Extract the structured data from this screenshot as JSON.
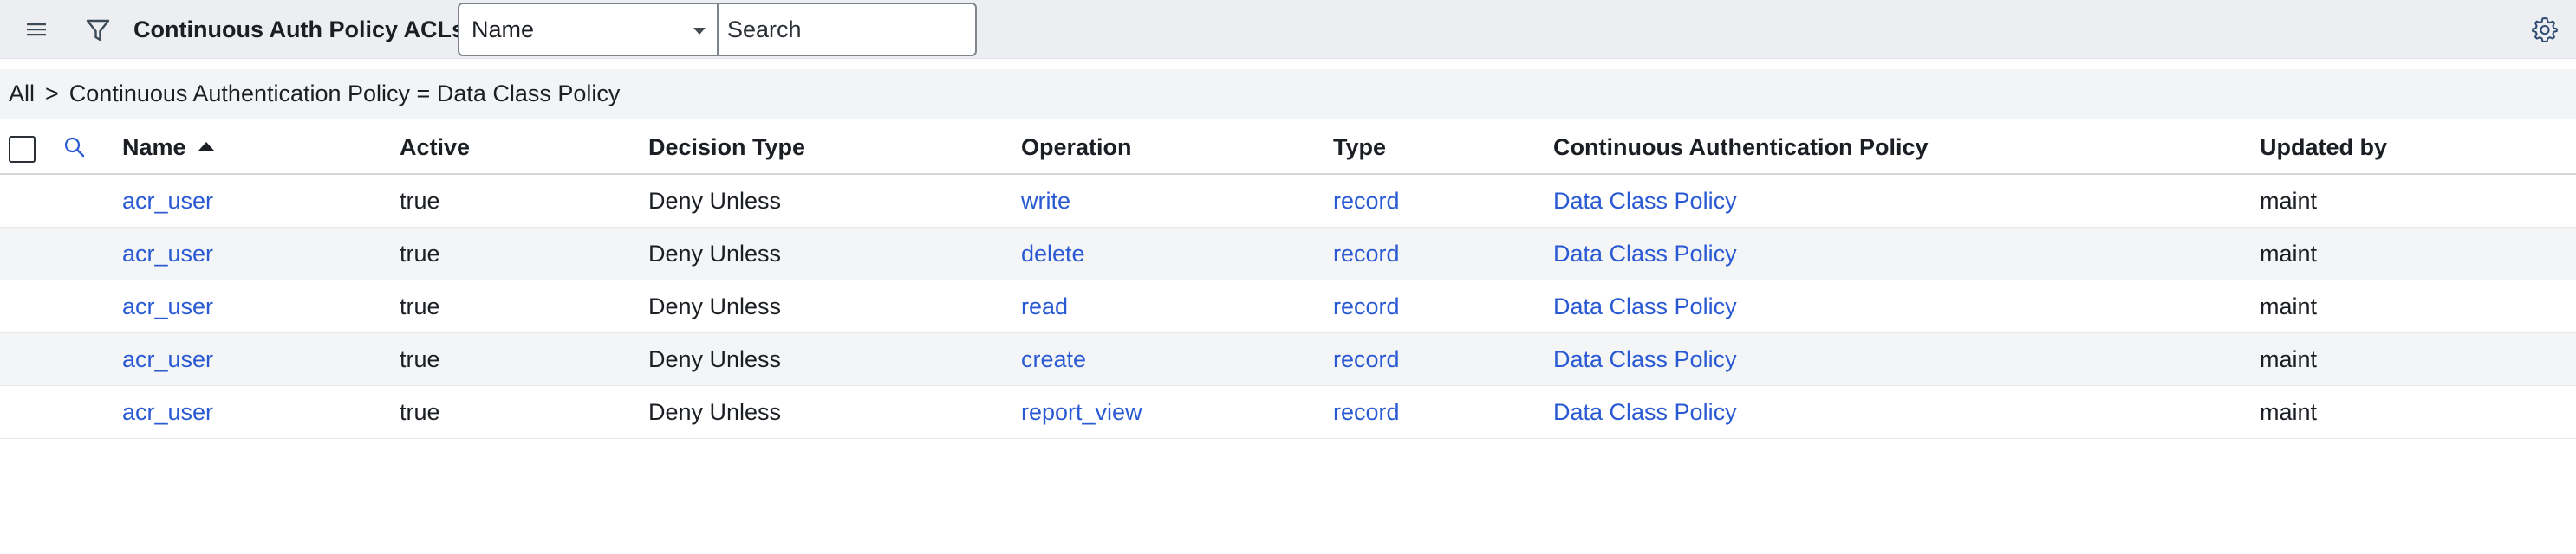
{
  "header": {
    "menu_icon": "hamburger-icon",
    "filter_icon": "funnel-filter-icon",
    "title": "Continuous Auth Policy ACLs",
    "field_select_value": "Name",
    "search_placeholder": "Search",
    "settings_icon": "gear-icon"
  },
  "breadcrumb": {
    "root": "All",
    "separator": ">",
    "condition": "Continuous Authentication Policy = Data Class Policy"
  },
  "table": {
    "columns": {
      "name": "Name",
      "active": "Active",
      "decision_type": "Decision Type",
      "operation": "Operation",
      "type": "Type",
      "policy": "Continuous Authentication Policy",
      "updated_by": "Updated by"
    },
    "sort": {
      "column": "Name",
      "direction": "ascending"
    },
    "rows": [
      {
        "name": "acr_user",
        "active": "true",
        "decision_type": "Deny Unless",
        "operation": "write",
        "type": "record",
        "policy": "Data Class Policy",
        "updated_by": "maint"
      },
      {
        "name": "acr_user",
        "active": "true",
        "decision_type": "Deny Unless",
        "operation": "delete",
        "type": "record",
        "policy": "Data Class Policy",
        "updated_by": "maint"
      },
      {
        "name": "acr_user",
        "active": "true",
        "decision_type": "Deny Unless",
        "operation": "read",
        "type": "record",
        "policy": "Data Class Policy",
        "updated_by": "maint"
      },
      {
        "name": "acr_user",
        "active": "true",
        "decision_type": "Deny Unless",
        "operation": "create",
        "type": "record",
        "policy": "Data Class Policy",
        "updated_by": "maint"
      },
      {
        "name": "acr_user",
        "active": "true",
        "decision_type": "Deny Unless",
        "operation": "report_view",
        "type": "record",
        "policy": "Data Class Policy",
        "updated_by": "maint"
      }
    ]
  },
  "colors": {
    "link": "#2a5ad3",
    "header_bg": "#eceef1",
    "alt_row_bg": "#f4f5f7"
  }
}
